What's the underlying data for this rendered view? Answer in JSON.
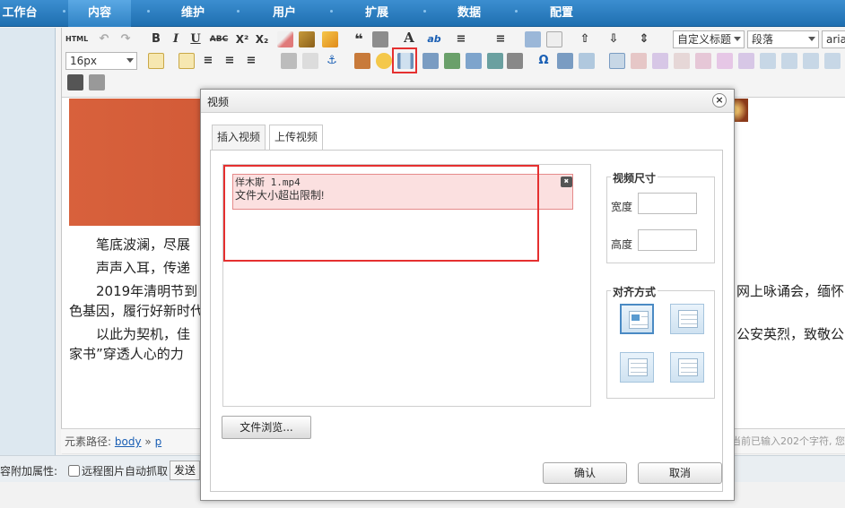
{
  "nav": {
    "items": [
      {
        "label": "工作台"
      },
      {
        "label": "内容"
      },
      {
        "label": "维护"
      },
      {
        "label": "用户"
      },
      {
        "label": "扩展"
      },
      {
        "label": "数据"
      },
      {
        "label": "配置"
      }
    ],
    "active": "内容"
  },
  "toolbar": {
    "html_label": "HTML",
    "font_size": "16px",
    "title_select": "自定义标题",
    "para_select": "段落",
    "font_select": "aria"
  },
  "content": {
    "paragraphs": [
      "笔底波澜，尽展",
      "声声入耳，传递",
      "2019年清明节到",
      "色基因，履行好新时代",
      "以此为契机，佳",
      "家书”穿透人心的力"
    ],
    "right_fragments": [
      "网上咏诵会，缅怀",
      "公安英烈，致敬公"
    ]
  },
  "statusbar": {
    "path_label": "元素路径:",
    "path_body": "body",
    "path_sep": "»",
    "path_p": "p",
    "word_count": "当前已输入202个字符, 您"
  },
  "bottom": {
    "attr_label": "容附加属性:",
    "remote_checkbox": "远程图片自动抓取",
    "send_button": "发送"
  },
  "modal": {
    "title": "视频",
    "close_symbol": "×",
    "tabs": [
      {
        "label": "插入视频"
      },
      {
        "label": "上传视频"
      }
    ],
    "active_tab": "上传视频",
    "upload": {
      "file_name": "佯木斯 1.mp4",
      "error_message": "文件大小超出限制!",
      "browse_button": "文件浏览..."
    },
    "size": {
      "legend": "视频尺寸",
      "width_label": "宽度",
      "height_label": "高度",
      "width_value": "",
      "height_value": ""
    },
    "align": {
      "legend": "对齐方式"
    },
    "confirm_button": "确认",
    "cancel_button": "取消"
  },
  "colors": {
    "nav_bg": "#1f6fb0",
    "highlight_red": "#e53030",
    "error_bg": "#fbe0e0",
    "banner": "#c8502f"
  }
}
